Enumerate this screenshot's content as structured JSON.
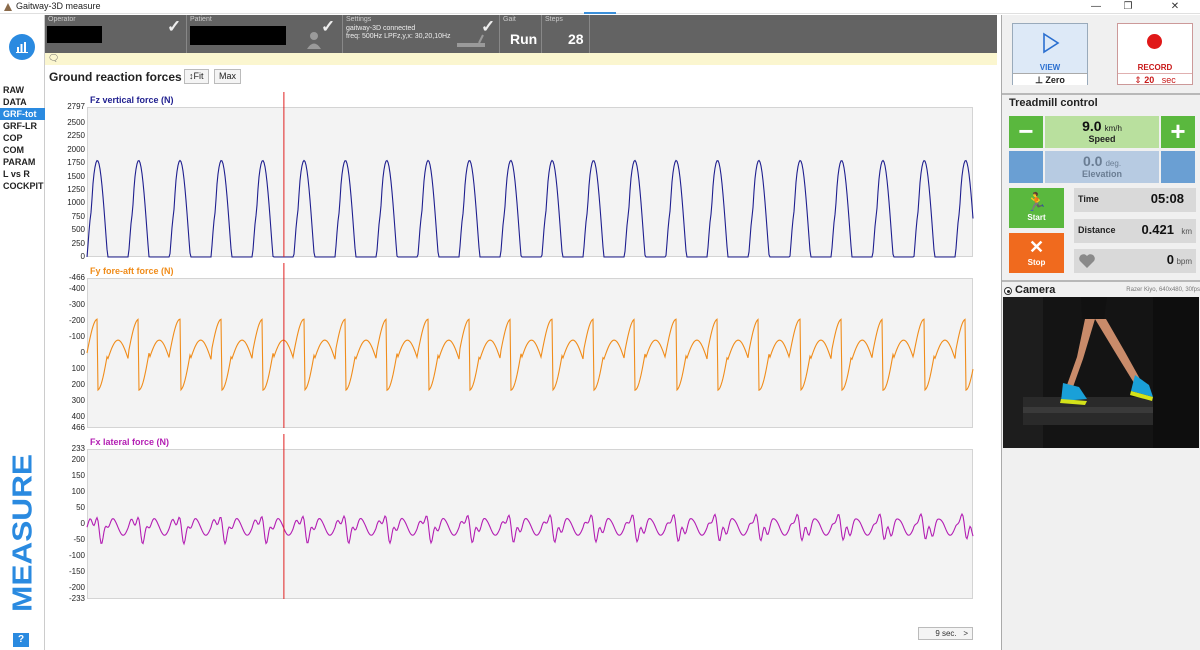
{
  "window": {
    "title": "Gaitway-3D measure",
    "minimize": "—",
    "restore": "❐",
    "close": "✕"
  },
  "sidebar": {
    "items": [
      {
        "label": "RAW"
      },
      {
        "label": "DATA"
      },
      {
        "label": "GRF-tot",
        "active": true
      },
      {
        "label": "GRF-LR"
      },
      {
        "label": "COP"
      },
      {
        "label": "COM"
      },
      {
        "label": "PARAM"
      },
      {
        "label": "L vs R"
      },
      {
        "label": "COCKPIT"
      }
    ],
    "section_label": "MEASURE",
    "help_label": "?",
    "accent_color": "#2a8ae0"
  },
  "header": {
    "operator_label": "Operator",
    "patient_label": "Patient",
    "settings_label": "Settings",
    "settings_status": "gaitway-3D connected",
    "settings_freq": "freq: 500Hz   LPFz,y,x: 30,20,10Hz",
    "gait_label": "Gait",
    "gait_value": "Run",
    "steps_label": "Steps",
    "steps_value": "28"
  },
  "main": {
    "title": "Ground reaction forces",
    "fit_label": "Fit",
    "max_label": "Max",
    "time_window": "9 sec.",
    "time_window_arrow": ">"
  },
  "charts": [
    {
      "title": "Fz vertical force (N)",
      "color": "#1f1f8f",
      "ticks": [
        "2797",
        "2500",
        "2250",
        "2000",
        "1750",
        "1500",
        "1250",
        "1000",
        "750",
        "500",
        "250",
        "0"
      ]
    },
    {
      "title": "Fy fore-aft force (N)",
      "color": "#f08c1a",
      "ticks": [
        "-466",
        "-400",
        "-300",
        "-200",
        "-100",
        "0",
        "100",
        "200",
        "300",
        "400",
        "466"
      ]
    },
    {
      "title": "Fx lateral force (N)",
      "color": "#b31eb3",
      "ticks": [
        "233",
        "200",
        "150",
        "100",
        "50",
        "0",
        "-50",
        "-100",
        "-150",
        "-200",
        "-233"
      ]
    }
  ],
  "chart_data": [
    {
      "type": "line",
      "title": "Fz vertical force (N)",
      "ylim": [
        0,
        2797
      ],
      "xlim_seconds": [
        0,
        9
      ],
      "cursor_time_s": 2.0,
      "step_period_s": 0.42,
      "peak_value": 1800,
      "min_value": 0,
      "series": [
        {
          "values": [
            1800,
            0,
            1800,
            0,
            1850,
            0,
            1800,
            0,
            1800,
            0,
            1800,
            0
          ]
        }
      ]
    },
    {
      "type": "line",
      "title": "Fy fore-aft force (N)",
      "ylim": [
        -466,
        466
      ],
      "xlim_seconds": [
        0,
        9
      ],
      "cursor_time_s": 2.0,
      "step_period_s": 0.42,
      "min_value": -210,
      "max_value": 240,
      "series": [
        {
          "values": [
            -180,
            240,
            -200,
            230,
            -210,
            235,
            -200,
            240,
            -190,
            230
          ]
        }
      ]
    },
    {
      "type": "line",
      "title": "Fx lateral force (N)",
      "ylim": [
        -233,
        233
      ],
      "xlim_seconds": [
        0,
        9
      ],
      "cursor_time_s": 2.0,
      "step_period_s": 0.42,
      "min_value": -60,
      "max_value": 60,
      "series": [
        {
          "values": [
            30,
            -50,
            40,
            -45,
            35,
            -55,
            45,
            -40,
            50,
            -60
          ]
        }
      ]
    }
  ],
  "controls": {
    "view_label": "VIEW",
    "zero_label": "Zero",
    "record_label": "RECORD",
    "record_duration": "20",
    "record_unit": "sec",
    "treadmill_heading": "Treadmill control",
    "speed_value": "9.0",
    "speed_unit": "km/h",
    "speed_label": "Speed",
    "minus_label": "−",
    "plus_label": "+",
    "elevation_value": "0.0",
    "elevation_unit": "deg.",
    "elevation_label": "Elevation",
    "start_label": "Start",
    "stop_label": "Stop",
    "time_label": "Time",
    "time_value": "05:08",
    "distance_label": "Distance",
    "distance_value": "0.421",
    "distance_unit": "km",
    "heart_value": "0",
    "heart_unit": "bpm",
    "camera_label": "Camera",
    "camera_info": "Razer Kiyo, 640x480, 30fps",
    "green": "#5ab83e",
    "orange": "#f06a1e",
    "blue": "#6a9fd3"
  }
}
